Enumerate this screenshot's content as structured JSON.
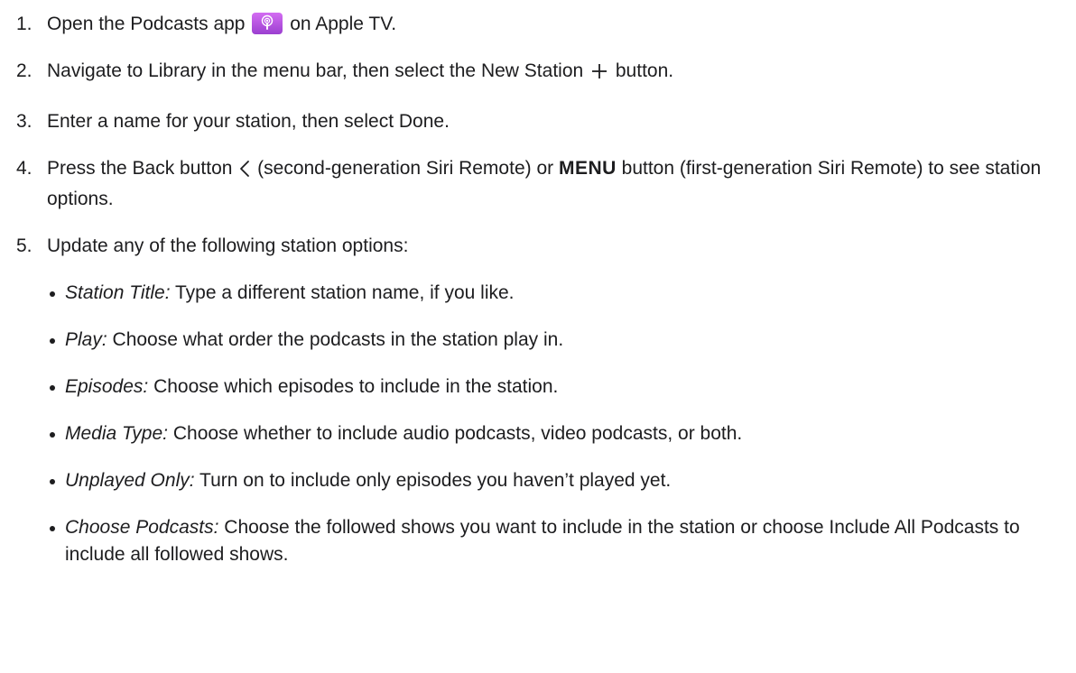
{
  "steps": [
    {
      "number": "1.",
      "before": "Open the Podcasts app",
      "icon": "podcasts-app-icon",
      "after": "on Apple TV."
    },
    {
      "number": "2.",
      "before": "Navigate to Library in the menu bar, then select the New Station",
      "icon": "plus-icon",
      "after": "button."
    },
    {
      "number": "3.",
      "text": "Enter a name for your station, then select Done."
    },
    {
      "number": "4.",
      "before": "Press the Back button",
      "icon": "chevron-left-icon",
      "middle": "(second-generation Siri Remote) or",
      "menu_key": "MENU",
      "after": "button (first-generation Siri Remote) to see station options."
    },
    {
      "number": "5.",
      "text": "Update any of the following station options:",
      "bullets": [
        {
          "term": "Station Title:",
          "desc": "Type a different station name, if you like."
        },
        {
          "term": "Play:",
          "desc": "Choose what order the podcasts in the station play in."
        },
        {
          "term": "Episodes:",
          "desc": "Choose which episodes to include in the station."
        },
        {
          "term": "Media Type:",
          "desc": "Choose whether to include audio podcasts, video podcasts, or both."
        },
        {
          "term": "Unplayed Only:",
          "desc": "Turn on to include only episodes you haven’t played yet."
        },
        {
          "term": "Choose Podcasts:",
          "desc": "Choose the followed shows you want to include in the station or choose Include All Podcasts to include all followed shows."
        }
      ]
    }
  ],
  "colors": {
    "text": "#1d1d1f",
    "podcasts_icon_top": "#d36cf2",
    "podcasts_icon_bottom": "#9b3fd0"
  }
}
